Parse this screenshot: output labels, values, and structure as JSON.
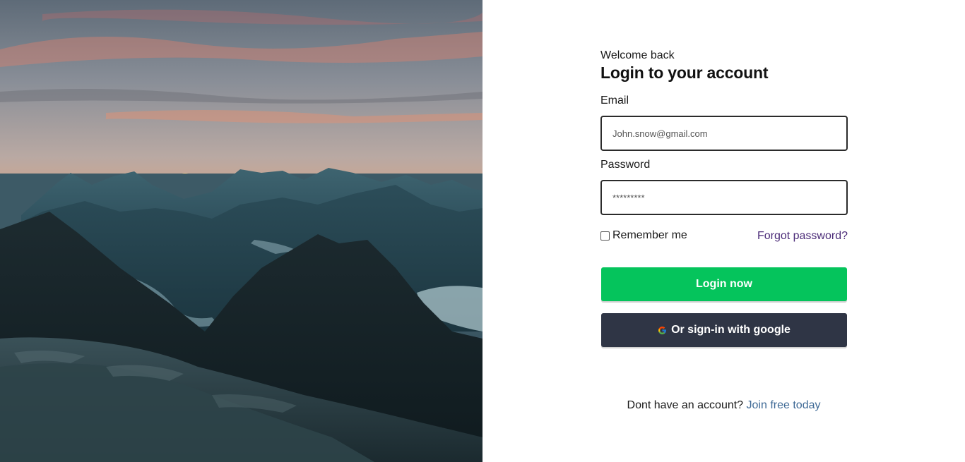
{
  "hero": {
    "image": "mountain-sunset-landscape"
  },
  "form": {
    "welcome": "Welcome back",
    "title": "Login to your account",
    "email_label": "Email",
    "email_placeholder": "John.snow@gmail.com",
    "password_label": "Password",
    "password_placeholder": "*********",
    "remember_label": "Remember me",
    "remember_checked": false,
    "forgot_link": "Forgot password?",
    "login_button": "Login now",
    "google_button": "Or sign-in with google",
    "signup_prompt": "Dont have an account?",
    "signup_link": "Join free today"
  },
  "colors": {
    "login_button": "#05c45c",
    "google_button": "#2f3545",
    "forgot_link": "#4b2b78",
    "signup_link": "#3f6a96"
  },
  "icons": {
    "google": "google-g-icon"
  }
}
